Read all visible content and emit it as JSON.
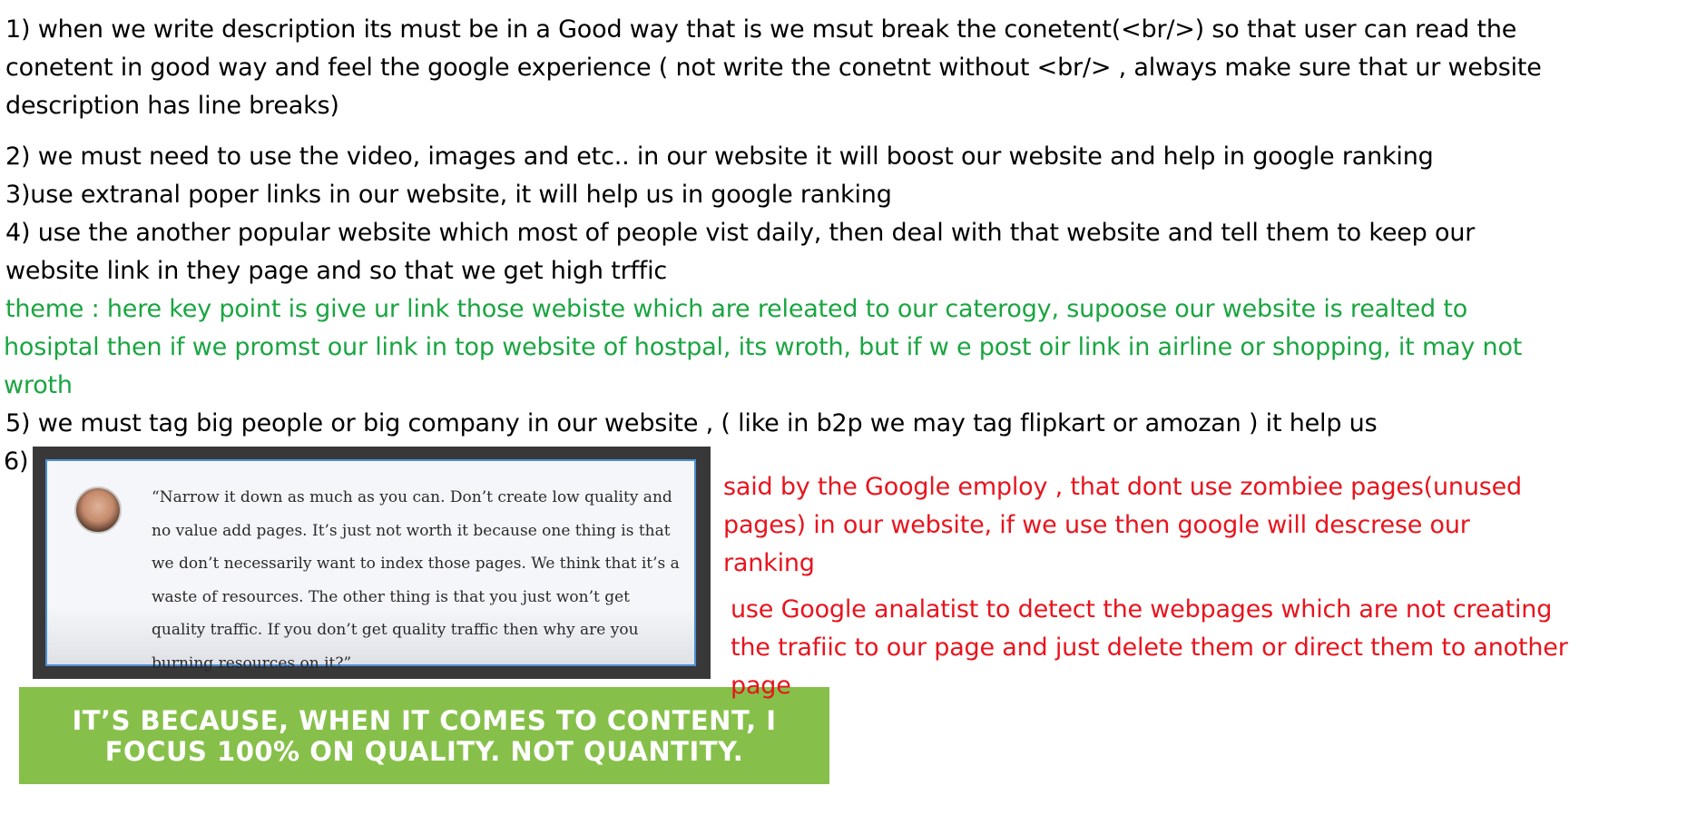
{
  "points": {
    "p1_l1": "1) when we write description its must be in a Good way that is we msut break the conetent(<br/>) so that user can read the",
    "p1_l2": "conetent in good way and feel the google experience ( not write the conetnt without <br/> , always make sure that ur website",
    "p1_l3": "description has line breaks)",
    "p2": "2) we must need to use the video, images and etc.. in our website it will boost our website and help in google ranking",
    "p3": "3)use extranal poper links in our website, it will help us in google ranking",
    "p4_l1": "4) use the another popular website which most of people vist daily, then deal with that website and tell them to keep our",
    "p4_l2": "website link in they page and so that we get high trffic",
    "theme_l1": "  theme : here key point is give ur link those webiste which are releated to our caterogy, supoose our website is realted to",
    "theme_l2": "hosiptal then if we promst our link in top website of hostpal, its wroth, but if w e post oir link in airline or shopping, it may not",
    "theme_l3": "wroth",
    "p5": "5) we must tag big people or big company in our website , ( like in b2p we may tag flipkart or amozan ) it help us",
    "p6": "6)"
  },
  "quote": {
    "text": "“Narrow it down as much as you can. Don’t create low quality and no value add pages. It’s just not worth it because one thing is that we don’t necessarily want to index those pages. We think that it’s a waste of resources. The other thing is that you just won’t get quality traffic. If you don’t get quality traffic then why are you burning resources on it?”"
  },
  "banner": {
    "text": "IT’S BECAUSE, WHEN IT COMES TO CONTENT, I FOCUS 100% ON QUALITY. NOT QUANTITY."
  },
  "notes": {
    "red1_l1": "said by the Google employ , that dont use zombiee pages(unused",
    "red1_l2": "pages) in our website, if we use then google will descrese our",
    "red1_l3": "ranking",
    "red2_l1": "use Google analatist to detect the webpages which are not creating",
    "red2_l2": "the trafiic to our page and just delete them or direct them to another",
    "red2_l3": "page"
  },
  "colors": {
    "green_text": "#1aa541",
    "red_text": "#e8141d",
    "banner_bg": "#86c04a"
  }
}
